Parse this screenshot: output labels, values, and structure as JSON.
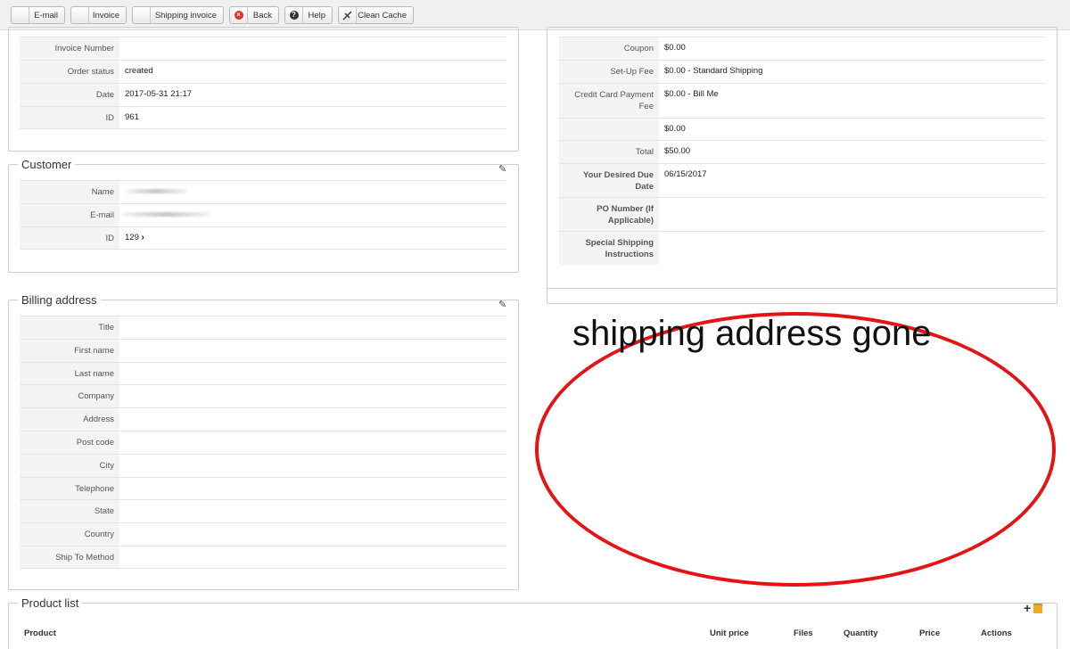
{
  "toolbar": {
    "buttons": [
      {
        "label": "E-mail",
        "icon": "email-icon"
      },
      {
        "label": "Invoice",
        "icon": "invoice-icon"
      },
      {
        "label": "Shipping invoice",
        "icon": "shipping-invoice-icon"
      },
      {
        "label": "Back",
        "icon": "close-icon"
      },
      {
        "label": "Help",
        "icon": "help-icon"
      },
      {
        "label": "Clean Cache",
        "icon": "broom-icon"
      }
    ]
  },
  "order": {
    "rows": [
      {
        "key": "Invoice Number",
        "value": ""
      },
      {
        "key": "Order status",
        "value": "created"
      },
      {
        "key": "Date",
        "value": "2017-05-31 21:17"
      },
      {
        "key": "ID",
        "value": "961"
      }
    ]
  },
  "customer": {
    "title": "Customer",
    "rows": [
      {
        "key": "Name",
        "value": ""
      },
      {
        "key": "E-mail",
        "value": ""
      },
      {
        "key": "ID",
        "value": "129"
      }
    ]
  },
  "billing": {
    "title": "Billing address",
    "rows": [
      {
        "key": "Title",
        "value": ""
      },
      {
        "key": "First name",
        "value": ""
      },
      {
        "key": "Last name",
        "value": ""
      },
      {
        "key": "Company",
        "value": ""
      },
      {
        "key": "Address",
        "value": ""
      },
      {
        "key": "Post code",
        "value": ""
      },
      {
        "key": "City",
        "value": ""
      },
      {
        "key": "Telephone",
        "value": ""
      },
      {
        "key": "State",
        "value": ""
      },
      {
        "key": "Country",
        "value": ""
      },
      {
        "key": "Ship To Method",
        "value": ""
      }
    ]
  },
  "summary": {
    "rows": [
      {
        "key": "Coupon",
        "value": "$0.00"
      },
      {
        "key": "Set-Up Fee",
        "value": "$0.00 - Standard Shipping"
      },
      {
        "key": "Credit Card Payment Fee",
        "value": "$0.00 - Bill Me"
      },
      {
        "key": "",
        "value": "$0.00"
      },
      {
        "key": "Total",
        "value": "$50.00"
      },
      {
        "key": "Your Desired Due Date",
        "value": "06/15/2017"
      },
      {
        "key": "PO Number (If Applicable)",
        "value": ""
      },
      {
        "key": "Special Shipping Instructions",
        "value": ""
      }
    ]
  },
  "annotation": {
    "text": "shipping address gone",
    "color": "#e41414"
  },
  "product_list": {
    "title": "Product list",
    "columns": [
      "Product",
      "Unit price",
      "Files",
      "Quantity",
      "Price",
      "Actions"
    ]
  }
}
